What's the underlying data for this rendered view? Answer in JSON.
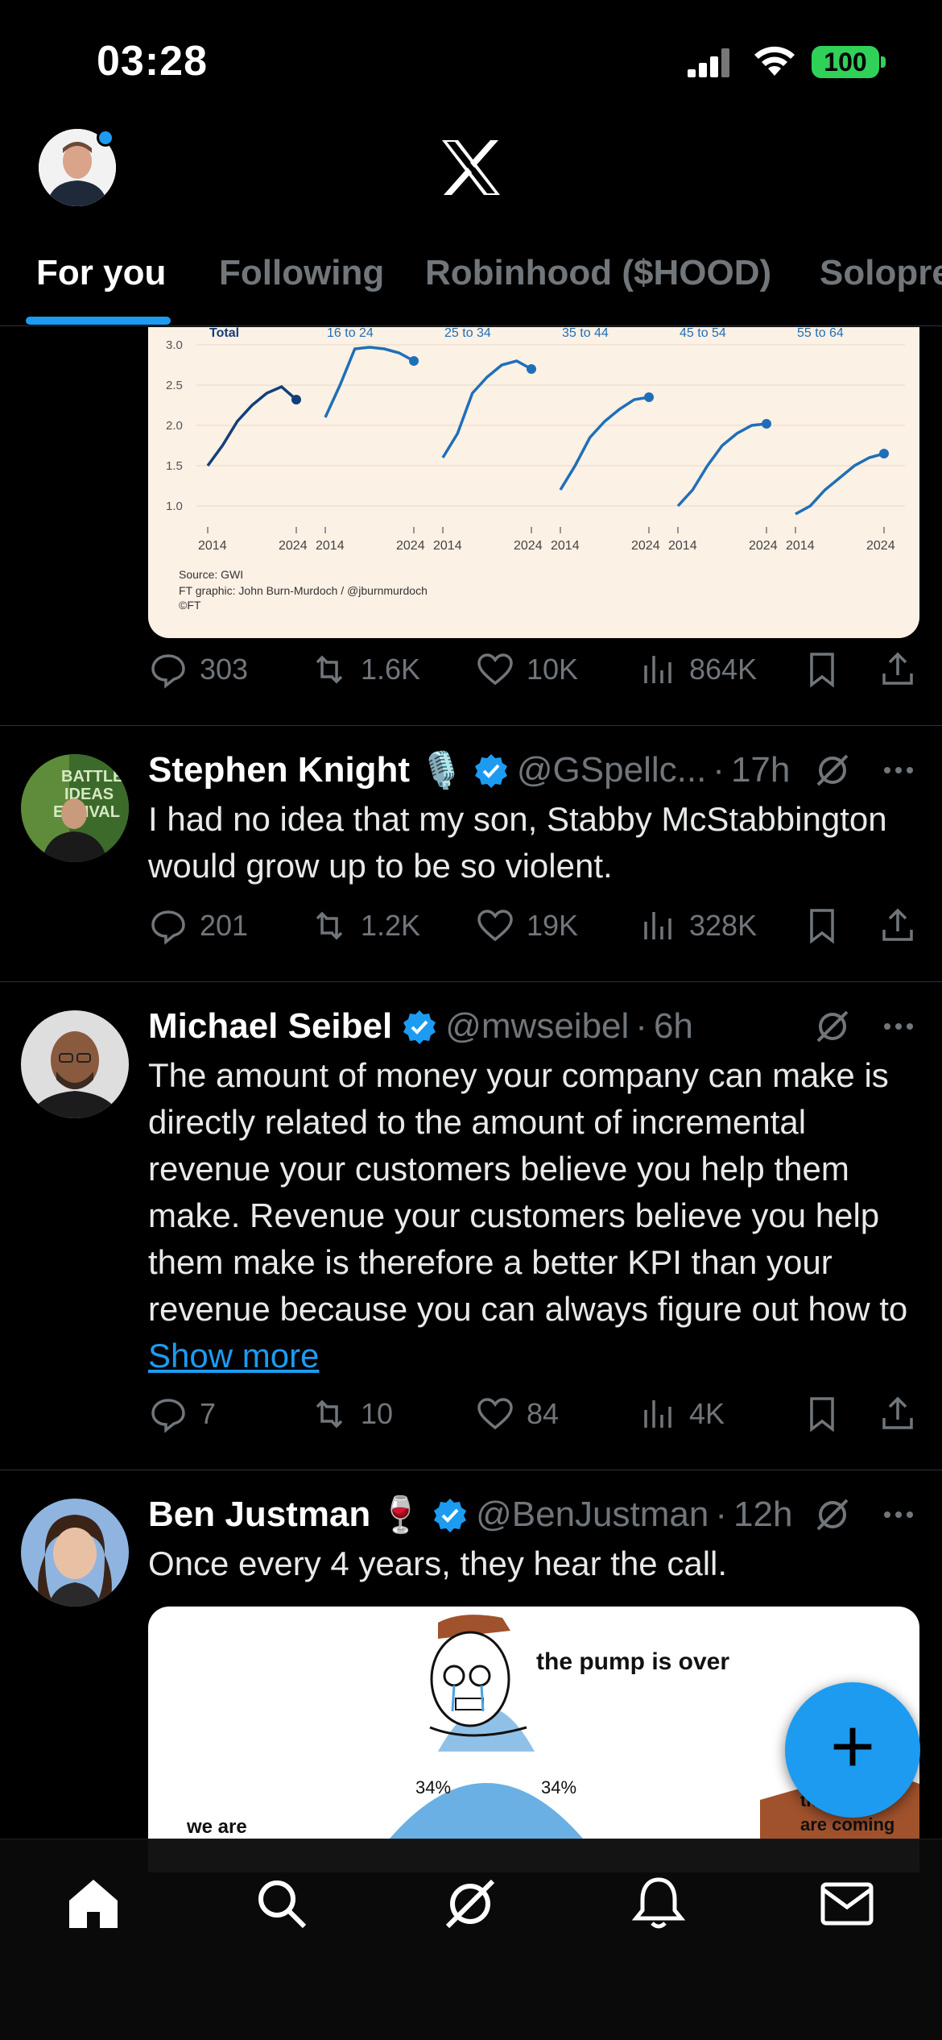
{
  "status_bar": {
    "time": "03:28",
    "battery": "100"
  },
  "header": {
    "avatar": "profile-avatar",
    "logo": "x-logo"
  },
  "tabs": [
    {
      "label": "For you",
      "active": true
    },
    {
      "label": "Following",
      "active": false
    },
    {
      "label": "Robinhood ($HOOD)",
      "active": false
    },
    {
      "label": "Solopre",
      "active": false
    }
  ],
  "chart_data": {
    "type": "line",
    "panels": [
      "Total",
      "16 to 24",
      "25 to 34",
      "35 to 44",
      "45 to 54",
      "55 to 64"
    ],
    "x_ticks": [
      "2014",
      "2024"
    ],
    "y_ticks": [
      "3.0",
      "2.5",
      "2.0",
      "1.5",
      "1.0"
    ],
    "ylim": [
      1.0,
      3.0
    ],
    "series": [
      {
        "name": "Total",
        "values": [
          1.5,
          1.75,
          2.05,
          2.25,
          2.4,
          2.48,
          2.32
        ]
      },
      {
        "name": "16 to 24",
        "values": [
          2.1,
          2.5,
          2.95,
          2.97,
          2.95,
          2.9,
          2.8
        ]
      },
      {
        "name": "25 to 34",
        "values": [
          1.6,
          1.9,
          2.4,
          2.6,
          2.75,
          2.8,
          2.7
        ]
      },
      {
        "name": "35 to 44",
        "values": [
          1.2,
          1.5,
          1.85,
          2.05,
          2.2,
          2.32,
          2.35
        ]
      },
      {
        "name": "45 to 54",
        "values": [
          1.0,
          1.2,
          1.5,
          1.75,
          1.9,
          2.0,
          2.02
        ]
      },
      {
        "name": "55 to 64",
        "values": [
          0.9,
          1.0,
          1.2,
          1.35,
          1.5,
          1.6,
          1.65
        ]
      }
    ],
    "source": "Source: GWI",
    "credit": "FT graphic: John Burn-Murdoch / @jburnmurdoch",
    "copyright": "©FT",
    "color": "#1f6fb8",
    "total_color": "#123f7a"
  },
  "post0": {
    "replies": "303",
    "reposts": "1.6K",
    "likes": "10K",
    "views": "864K"
  },
  "posts": [
    {
      "name": "Stephen Knight",
      "emoji": "🎙️",
      "handle": "@GSpellc...",
      "time": "17h",
      "text": "I had no idea that my son, Stabby McStabbington would grow up to be so violent.",
      "replies": "201",
      "reposts": "1.2K",
      "likes": "19K",
      "views": "328K",
      "avatar_text": "BATTLE IDEAS ESTIVAL"
    },
    {
      "name": "Michael Seibel",
      "handle": "@mwseibel",
      "time": "6h",
      "text": "The amount of money your company can make is directly related to the amount of incremental revenue your customers believe you help them make.  Revenue your customers believe you help them make is therefore a better KPI than your revenue because you can always figure out how to",
      "show_more": "Show more",
      "replies": "7",
      "reposts": "10",
      "likes": "84",
      "views": "4K"
    },
    {
      "name": "Ben Justman",
      "emoji": "🍷",
      "handle": "@BenJustman",
      "time": "12h",
      "text": "Once every 4 years, they hear the call."
    }
  ],
  "meme": {
    "speech": "the pump is over",
    "left_pct": "34%",
    "right_pct": "34%",
    "left_text": "we are",
    "right_text_top": "th...us",
    "right_text_bottom": "are coming"
  },
  "separator": "·",
  "colors": {
    "accent": "#1d9bf0",
    "muted": "#71767b",
    "background": "#000000"
  }
}
